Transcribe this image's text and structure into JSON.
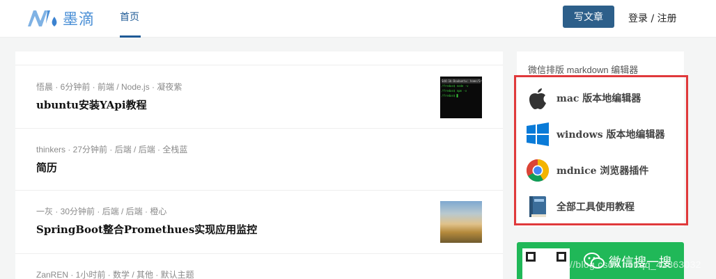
{
  "header": {
    "logo_text": "墨滴",
    "nav_home": "首页",
    "write_button": "写文章",
    "login_register": "登录 / 注册"
  },
  "articles": [
    {
      "meta": "悟晨 · 6分钟前 · 前端 / Node.js · 凝夜紫",
      "title": "ubuntu安装YApi教程",
      "thumb_lines": [
        "Sd4-1b-Doubuntu: home/Sreda",
        "/fredas$ node -v",
        "/fredas$ npm -v",
        "",
        "/fredas$ ▊"
      ]
    },
    {
      "meta": "thinkers · 27分钟前 · 后端 / 后端 · 全栈蓝",
      "title": "简历"
    },
    {
      "meta": "一灰 · 30分钟前 · 后端 / 后端 · 橙心",
      "title": "SpringBoot整合Promethues实现应用监控"
    },
    {
      "meta": "ZanREN · 1小时前 · 数学 / 其他 · 默认主题",
      "title": ""
    }
  ],
  "sidebar": {
    "title": "微信排版 markdown 编辑器",
    "tools": [
      {
        "label": "mac 版本地编辑器",
        "icon": "apple-icon"
      },
      {
        "label": "windows 版本地编辑器",
        "icon": "windows-icon"
      },
      {
        "label": "mdnice 浏览器插件",
        "icon": "chrome-icon"
      },
      {
        "label": "全部工具使用教程",
        "icon": "book-icon"
      }
    ],
    "wechat_text": "微信搜一搜",
    "watermark": "https://blog.csdn.net/qq_42363032"
  },
  "colors": {
    "accent": "#2d5f8a",
    "highlight_frame": "#e0393b",
    "wechat_green": "#20b858"
  }
}
